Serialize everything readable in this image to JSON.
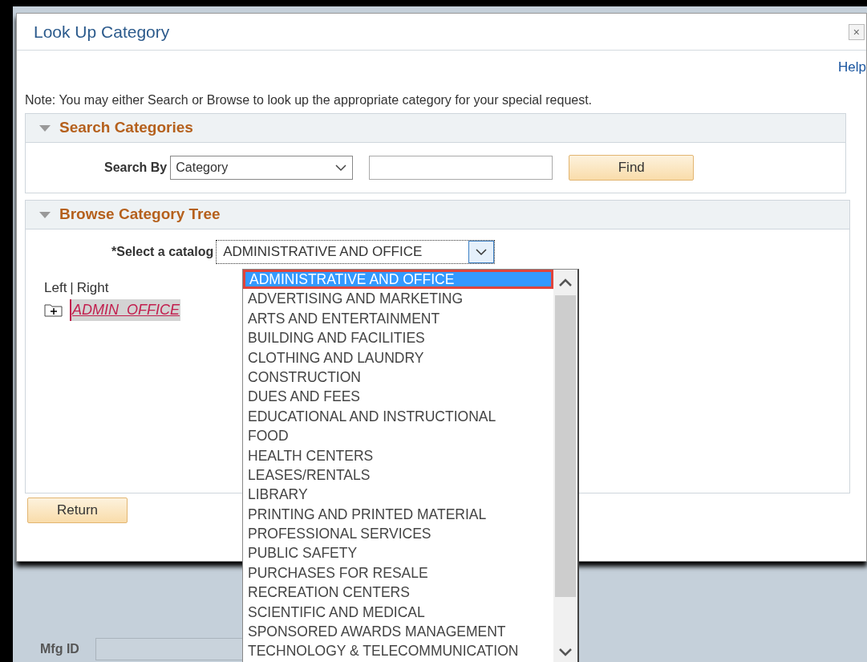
{
  "dialog": {
    "title": "Look Up Category",
    "close": "×",
    "help": "Help",
    "note": "Note: You may either Search or Browse to look up the appropriate category for your special request.",
    "search_panel": {
      "title": "Search Categories",
      "expanded": true,
      "search_by_label": "Search By",
      "search_by_value": "Category",
      "find_button": "Find"
    },
    "browse_panel": {
      "title": "Browse Category Tree",
      "expanded": true,
      "catalog_label": "*Select a catalog",
      "catalog_value": "ADMINISTRATIVE AND OFFICE",
      "left_link": "Left",
      "separator": "|",
      "right_link": "Right",
      "tree": [
        {
          "label": "ADMIN_OFFICE",
          "expanded": false
        }
      ]
    },
    "return_button": "Return"
  },
  "catalog_options": [
    {
      "label": "ADMINISTRATIVE AND OFFICE",
      "selected": true
    },
    {
      "label": "ADVERTISING AND MARKETING",
      "selected": false
    },
    {
      "label": "ARTS AND ENTERTAINMENT",
      "selected": false
    },
    {
      "label": "BUILDING AND FACILITIES",
      "selected": false
    },
    {
      "label": "CLOTHING AND LAUNDRY",
      "selected": false
    },
    {
      "label": "CONSTRUCTION",
      "selected": false
    },
    {
      "label": "DUES AND FEES",
      "selected": false
    },
    {
      "label": "EDUCATIONAL AND INSTRUCTIONAL",
      "selected": false
    },
    {
      "label": "FOOD",
      "selected": false
    },
    {
      "label": "HEALTH CENTERS",
      "selected": false
    },
    {
      "label": "LEASES/RENTALS",
      "selected": false
    },
    {
      "label": "LIBRARY",
      "selected": false
    },
    {
      "label": "PRINTING AND PRINTED MATERIAL",
      "selected": false
    },
    {
      "label": "PROFESSIONAL SERVICES",
      "selected": false
    },
    {
      "label": "PUBLIC SAFETY",
      "selected": false
    },
    {
      "label": "PURCHASES FOR RESALE",
      "selected": false
    },
    {
      "label": "RECREATION CENTERS",
      "selected": false
    },
    {
      "label": "SCIENTIFIC AND MEDICAL",
      "selected": false
    },
    {
      "label": "SPONSORED AWARDS MANAGEMENT",
      "selected": false
    },
    {
      "label": "TECHNOLOGY & TELECOMMUNICATION",
      "selected": false
    }
  ],
  "background_form": {
    "mfg_id_label": "Mfg ID"
  }
}
